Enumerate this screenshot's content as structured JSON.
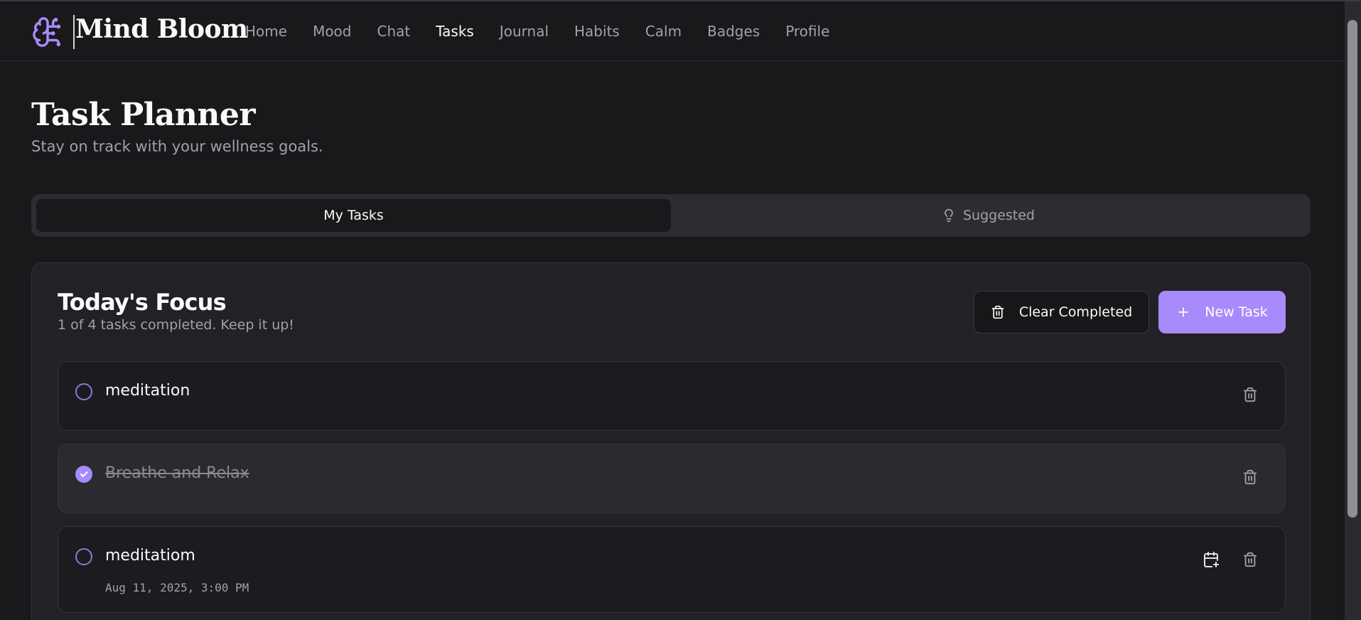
{
  "app": {
    "name": "Mind Bloom",
    "logo_icon": "brain-icon",
    "accent": "#a78bfa"
  },
  "nav": {
    "items": [
      {
        "label": "Home",
        "active": false
      },
      {
        "label": "Mood",
        "active": false
      },
      {
        "label": "Chat",
        "active": false
      },
      {
        "label": "Tasks",
        "active": true
      },
      {
        "label": "Journal",
        "active": false
      },
      {
        "label": "Habits",
        "active": false
      },
      {
        "label": "Calm",
        "active": false
      },
      {
        "label": "Badges",
        "active": false
      },
      {
        "label": "Profile",
        "active": false
      }
    ]
  },
  "page": {
    "title": "Task Planner",
    "subtitle": "Stay on track with your wellness goals."
  },
  "tabs": {
    "my_tasks": "My Tasks",
    "suggested": "Suggested",
    "suggested_icon": "lightbulb-icon",
    "selected": "My Tasks"
  },
  "focus": {
    "title": "Today's Focus",
    "summary": "1 of 4 tasks completed. Keep it up!",
    "clear_label": "Clear Completed",
    "clear_icon": "trash-icon",
    "new_label": "New Task",
    "new_icon": "plus-icon"
  },
  "tasks": [
    {
      "name": "meditation",
      "completed": false,
      "date": ""
    },
    {
      "name": "Breathe and Relax",
      "completed": true,
      "date": ""
    },
    {
      "name": "meditatiom",
      "completed": false,
      "date": "Aug 11, 2025, 3:00 PM"
    }
  ]
}
